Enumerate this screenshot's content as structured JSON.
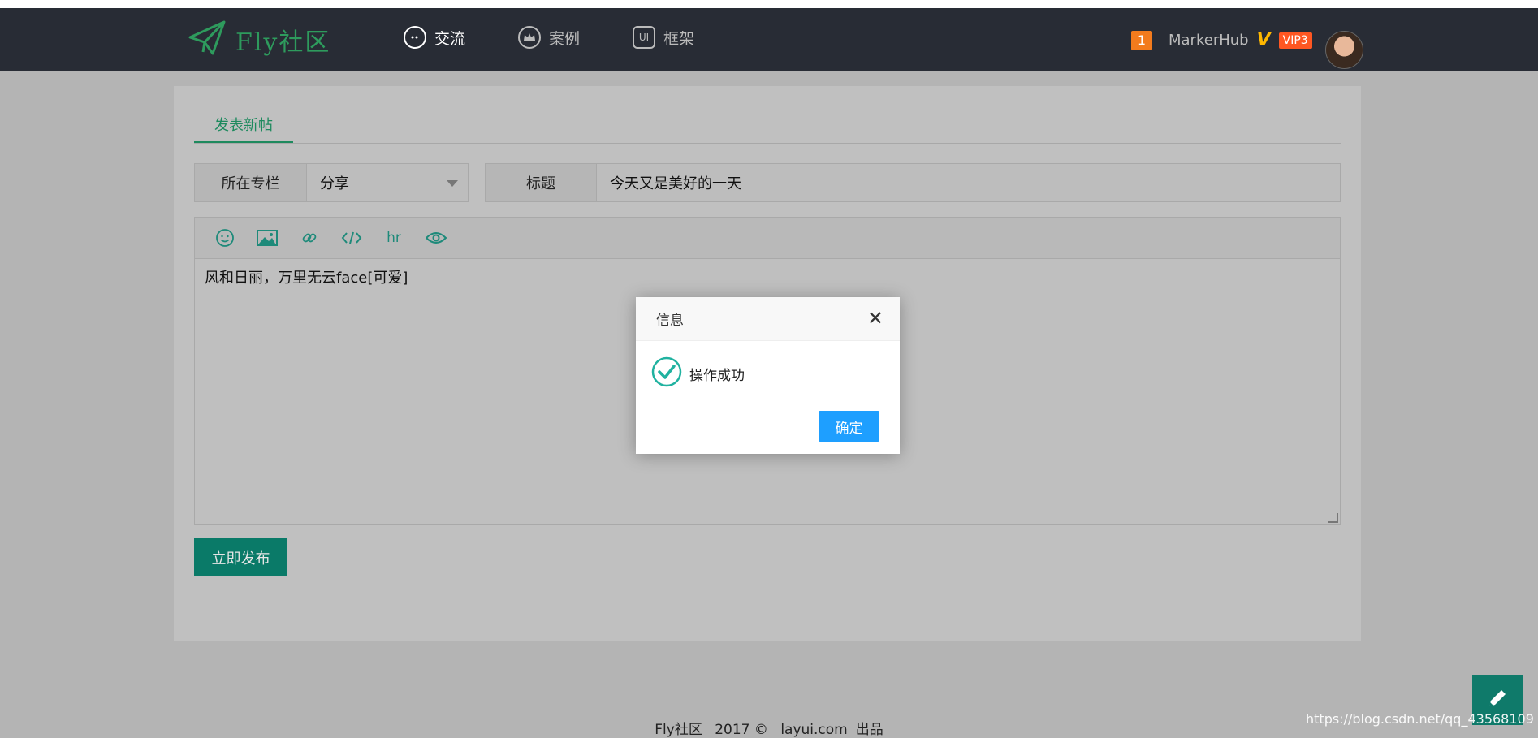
{
  "navbar": {
    "logo_text": "Fly社区",
    "items": [
      {
        "label": "交流",
        "icon": "chat-icon"
      },
      {
        "label": "案例",
        "icon": "crown-icon"
      },
      {
        "label": "框架",
        "icon": "ui-icon",
        "icon_text": "UI"
      }
    ],
    "message_count": "1",
    "username": "MarkerHub",
    "verified_mark": "V",
    "vip_label": "VIP3"
  },
  "form": {
    "tab_label": "发表新帖",
    "column_label": "所在专栏",
    "column_value": "分享",
    "title_label": "标题",
    "title_value": "今天又是美好的一天",
    "toolbar": {
      "hr_label": "hr"
    },
    "content": "风和日丽，万里无云face[可爱]",
    "publish_label": "立即发布"
  },
  "dialog": {
    "title": "信息",
    "close_symbol": "✕",
    "message": "操作成功",
    "ok_label": "确定"
  },
  "footer": {
    "site": "Fly社区",
    "year": "2017 ©",
    "link": "layui.com",
    "suffix": "出品"
  },
  "watermark": "https://blog.csdn.net/qq_43568109",
  "colors": {
    "accent_green": "#1e8a5e",
    "dialog_button": "#1e9fff",
    "badge_orange": "#f37b1d",
    "vip_red": "#ff5722"
  }
}
